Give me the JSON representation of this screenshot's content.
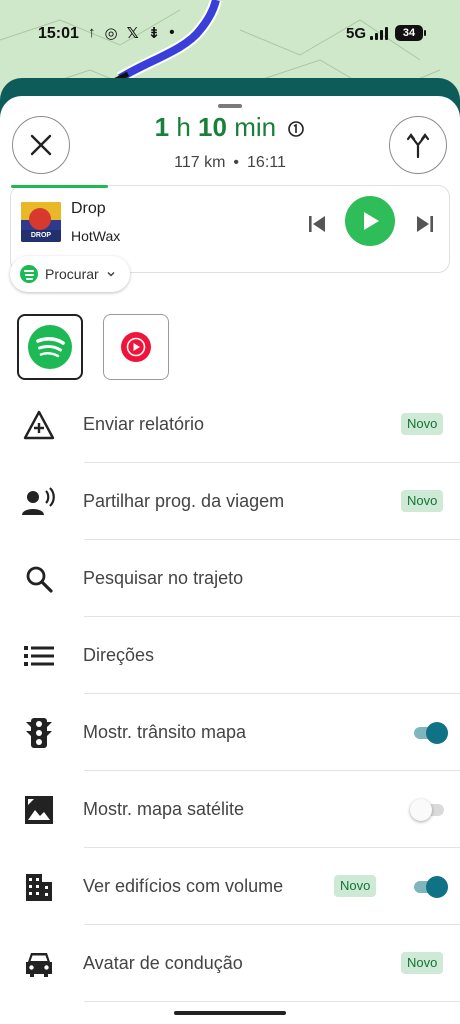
{
  "status_bar": {
    "time": "15:01",
    "icons": [
      "location-arrow-icon",
      "whatsapp-icon",
      "x-icon",
      "app-icon",
      "dot-icon"
    ],
    "network": "5G",
    "battery": "34"
  },
  "trip": {
    "eta_hours": "1",
    "eta_hours_unit": "h",
    "eta_minutes": "10",
    "eta_minutes_unit": "min",
    "distance": "117 km",
    "separator": "•",
    "arrival": "16:11",
    "eta_color": "#188038"
  },
  "media": {
    "album_text": "DROP",
    "title": "Drop",
    "artist": "HotWax",
    "progress": 0.22,
    "source_label": "Procurar",
    "accent": "#1db954"
  },
  "apps": [
    "spotify-icon",
    "youtube-music-icon"
  ],
  "menu": [
    {
      "label": "Enviar relatório",
      "icon": "report-triangle-icon",
      "badge": "Novo"
    },
    {
      "label": "Partilhar prog. da viagem",
      "icon": "share-progress-icon",
      "badge": "Novo"
    },
    {
      "label": "Pesquisar no trajeto",
      "icon": "search-icon"
    },
    {
      "label": "Direções",
      "icon": "list-icon"
    },
    {
      "label": "Mostr. trânsito mapa",
      "icon": "traffic-light-icon",
      "toggle": true
    },
    {
      "label": "Mostr. mapa satélite",
      "icon": "satellite-icon",
      "toggle": false
    },
    {
      "label": "Ver edifícios com volume",
      "icon": "buildings-icon",
      "badge": "Novo",
      "toggle": true
    },
    {
      "label": "Avatar de condução",
      "icon": "car-icon",
      "badge": "Novo"
    }
  ]
}
